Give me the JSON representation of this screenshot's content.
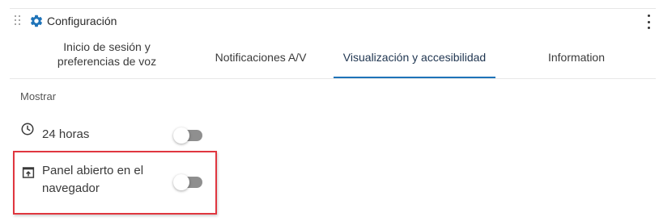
{
  "header": {
    "title": "Configuración",
    "drag_icon": "drag-handle-icon",
    "settings_icon": "gear-icon",
    "menu_icon": "more-vert-icon"
  },
  "tabs": [
    {
      "label_line1": "Inicio de sesión y",
      "label_line2": "preferencias de voz",
      "active": false
    },
    {
      "label": "Notificaciones A/V",
      "active": false
    },
    {
      "label": "Visualización y accesibilidad",
      "active": true
    },
    {
      "label": "Information",
      "active": false
    }
  ],
  "section": {
    "label": "Mostrar"
  },
  "settings": [
    {
      "icon": "clock-icon",
      "label": "24 horas",
      "enabled": false
    },
    {
      "icon": "open-in-browser-icon",
      "label_line1": "Panel abierto en el",
      "label_line2": "navegador",
      "enabled": false,
      "highlighted": true
    }
  ],
  "colors": {
    "accent": "#1e73b8",
    "highlight_border": "#e0363f",
    "toggle_off": "#8f8f8f",
    "icon": "#1e73b8"
  }
}
